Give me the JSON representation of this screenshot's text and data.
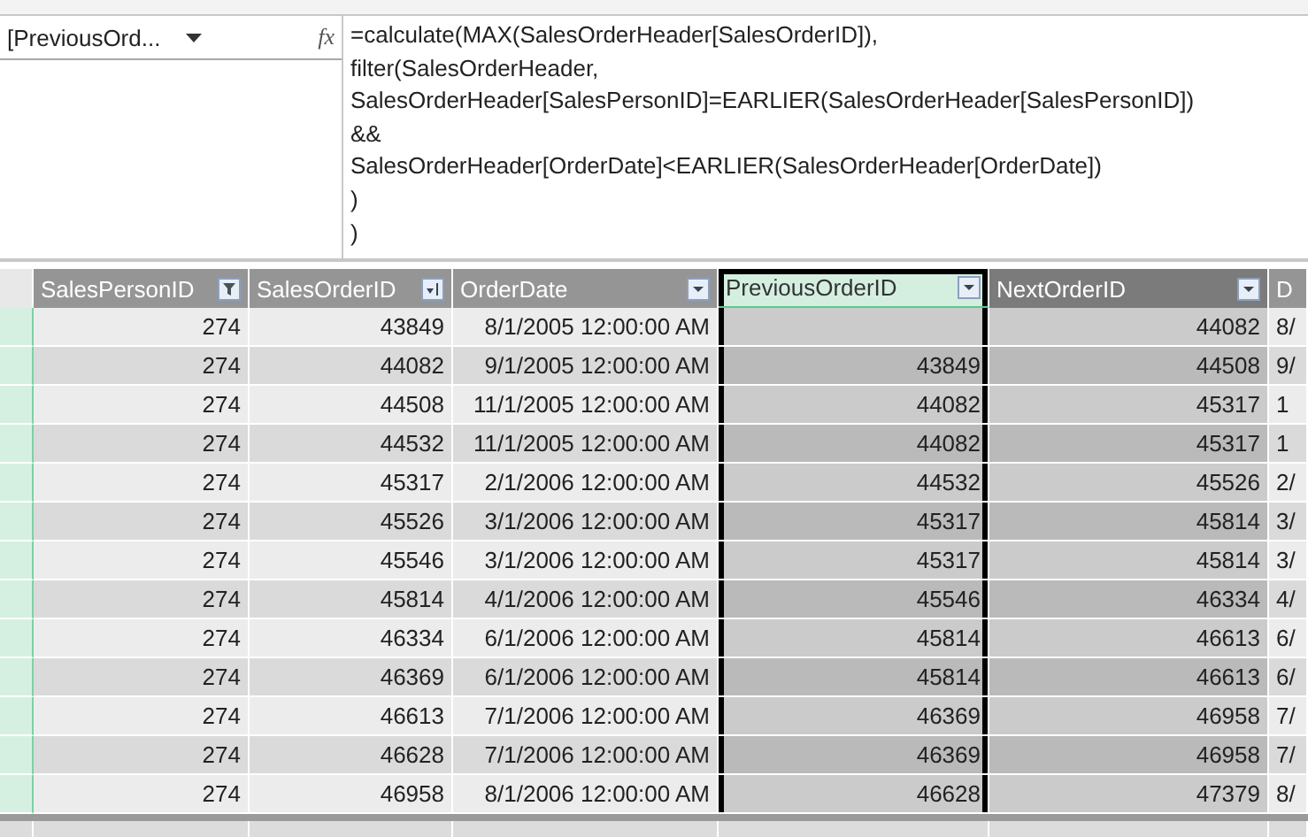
{
  "formula_bar": {
    "name_box": "[PreviousOrd...",
    "fx": "fx",
    "formula_lines": [
      "=calculate(MAX(SalesOrderHeader[SalesOrderID]),",
      "filter(SalesOrderHeader,",
      "SalesOrderHeader[SalesPersonID]=EARLIER(SalesOrderHeader[SalesPersonID])",
      "&&",
      "SalesOrderHeader[OrderDate]<EARLIER(SalesOrderHeader[OrderDate])",
      ")",
      ")"
    ]
  },
  "table": {
    "columns": [
      {
        "label": "SalesPersonID",
        "kind": "filter",
        "selected": false,
        "calculated": false
      },
      {
        "label": "SalesOrderID",
        "kind": "sort",
        "selected": false,
        "calculated": false
      },
      {
        "label": "OrderDate",
        "kind": "dropdown",
        "selected": false,
        "calculated": false
      },
      {
        "label": "PreviousOrderID",
        "kind": "dropdown",
        "selected": true,
        "calculated": true
      },
      {
        "label": "NextOrderID",
        "kind": "dropdown",
        "selected": false,
        "calculated": true
      },
      {
        "label": "D",
        "kind": "none",
        "selected": false,
        "calculated": false
      }
    ],
    "rows": [
      [
        "274",
        "43849",
        "8/1/2005 12:00:00 AM",
        "",
        "44082",
        "8/"
      ],
      [
        "274",
        "44082",
        "9/1/2005 12:00:00 AM",
        "43849",
        "44508",
        "9/"
      ],
      [
        "274",
        "44508",
        "11/1/2005 12:00:00 AM",
        "44082",
        "45317",
        "1"
      ],
      [
        "274",
        "44532",
        "11/1/2005 12:00:00 AM",
        "44082",
        "45317",
        "1"
      ],
      [
        "274",
        "45317",
        "2/1/2006 12:00:00 AM",
        "44532",
        "45526",
        "2/"
      ],
      [
        "274",
        "45526",
        "3/1/2006 12:00:00 AM",
        "45317",
        "45814",
        "3/"
      ],
      [
        "274",
        "45546",
        "3/1/2006 12:00:00 AM",
        "45317",
        "45814",
        "3/"
      ],
      [
        "274",
        "45814",
        "4/1/2006 12:00:00 AM",
        "45546",
        "46334",
        "4/"
      ],
      [
        "274",
        "46334",
        "6/1/2006 12:00:00 AM",
        "45814",
        "46613",
        "6/"
      ],
      [
        "274",
        "46369",
        "6/1/2006 12:00:00 AM",
        "45814",
        "46613",
        "6/"
      ],
      [
        "274",
        "46613",
        "7/1/2006 12:00:00 AM",
        "46369",
        "46958",
        "7/"
      ],
      [
        "274",
        "46628",
        "7/1/2006 12:00:00 AM",
        "46369",
        "46958",
        "7/"
      ],
      [
        "274",
        "46958",
        "8/1/2006 12:00:00 AM",
        "46628",
        "47379",
        "8/"
      ]
    ]
  }
}
